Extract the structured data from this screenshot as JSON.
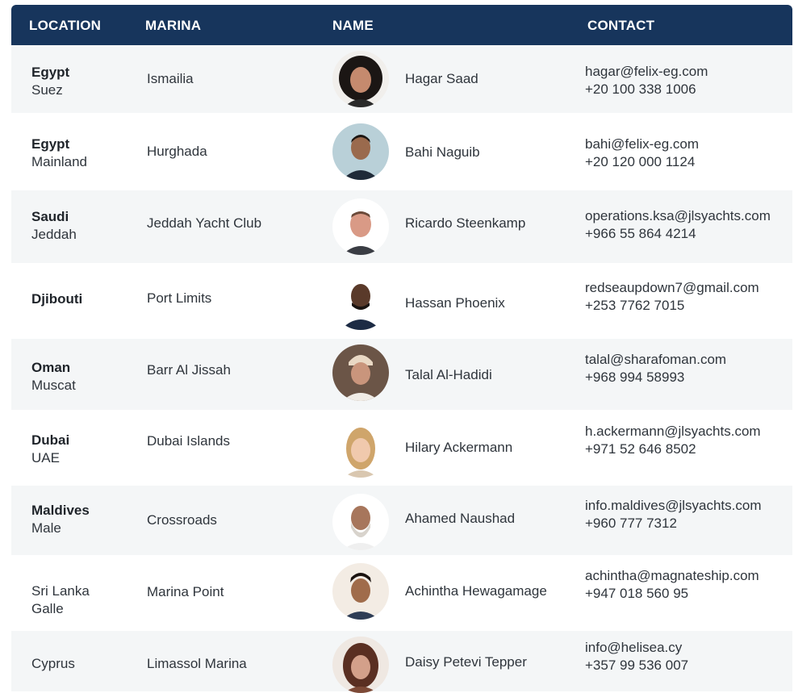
{
  "table": {
    "headers": {
      "location": "LOCATION",
      "marina": "MARINA",
      "name": "NAME",
      "contact": "CONTACT"
    },
    "rows": [
      {
        "country": "Egypt",
        "city": "Suez",
        "marina": "Ismailia",
        "name": "Hagar Saad",
        "email": "hagar@felix-eg.com",
        "phone": "+20 100 338 1006"
      },
      {
        "country": "Egypt",
        "city": "Mainland",
        "marina": "Hurghada",
        "name": "Bahi Naguib",
        "email": "bahi@felix-eg.com",
        "phone": "+20 120 000 1124"
      },
      {
        "country": "Saudi",
        "city": "Jeddah",
        "marina": "Jeddah Yacht Club",
        "name": "Ricardo Steenkamp",
        "email": "operations.ksa@jlsyachts.com",
        "phone": "+966 55 864 4214"
      },
      {
        "country": "Djibouti",
        "city": "",
        "marina": "Port Limits",
        "name": "Hassan Phoenix",
        "email": "redseaupdown7@gmail.com",
        "phone": "+253 7762 7015"
      },
      {
        "country": "Oman",
        "city": "Muscat",
        "marina": "Barr Al Jissah",
        "name": "Talal Al-Hadidi",
        "email": "talal@sharafoman.com",
        "phone": "+968 994 58993"
      },
      {
        "country": "Dubai",
        "city": "UAE",
        "marina": "Dubai Islands",
        "name": "Hilary Ackermann",
        "email": "h.ackermann@jlsyachts.com",
        "phone": "+971 52 646 8502"
      },
      {
        "country": "Maldives",
        "city": "Male",
        "marina": "Crossroads",
        "name": "Ahamed Naushad",
        "email": "info.maldives@jlsyachts.com",
        "phone": "+960 777 7312"
      },
      {
        "country": "Sri Lanka",
        "city": "Galle",
        "marina": "Marina Point",
        "name": "Achintha Hewagamage",
        "email": "achintha@magnateship.com",
        "phone": "+947 018 560 95"
      },
      {
        "country": "Cyprus",
        "city": "",
        "marina": "Limassol Marina",
        "name": "Daisy Petevi Tepper",
        "email": "info@helisea.cy",
        "phone": "+357 99 536 007"
      }
    ]
  },
  "colors": {
    "header_bg": "#17355c",
    "row_alt_bg": "#f4f6f7"
  }
}
